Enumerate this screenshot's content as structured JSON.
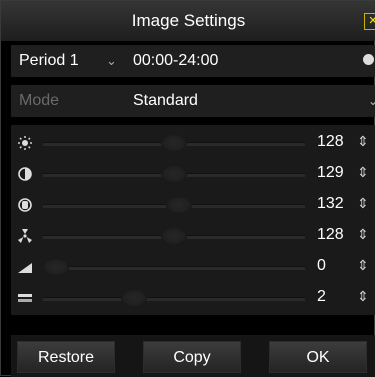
{
  "window": {
    "title": "Image Settings"
  },
  "period": {
    "label": "Period 1",
    "time_range": "00:00-24:00"
  },
  "mode": {
    "label": "Mode",
    "value": "Standard"
  },
  "sliders": [
    {
      "name": "brightness",
      "icon": "brightness-icon",
      "value": "128",
      "level": 0.5
    },
    {
      "name": "contrast",
      "icon": "contrast-icon",
      "value": "129",
      "level": 0.5
    },
    {
      "name": "saturation",
      "icon": "saturation-icon",
      "value": "132",
      "level": 0.52
    },
    {
      "name": "hue",
      "icon": "hue-icon",
      "value": "128",
      "level": 0.5
    },
    {
      "name": "sharpness",
      "icon": "sharpness-icon",
      "value": "0",
      "level": 0.0
    },
    {
      "name": "denoising",
      "icon": "denoising-icon",
      "value": "2",
      "level": 0.33
    }
  ],
  "buttons": {
    "restore": "Restore",
    "copy": "Copy",
    "ok": "OK"
  },
  "colors": {
    "background": "#000000",
    "accent_close": "#ffe800"
  }
}
